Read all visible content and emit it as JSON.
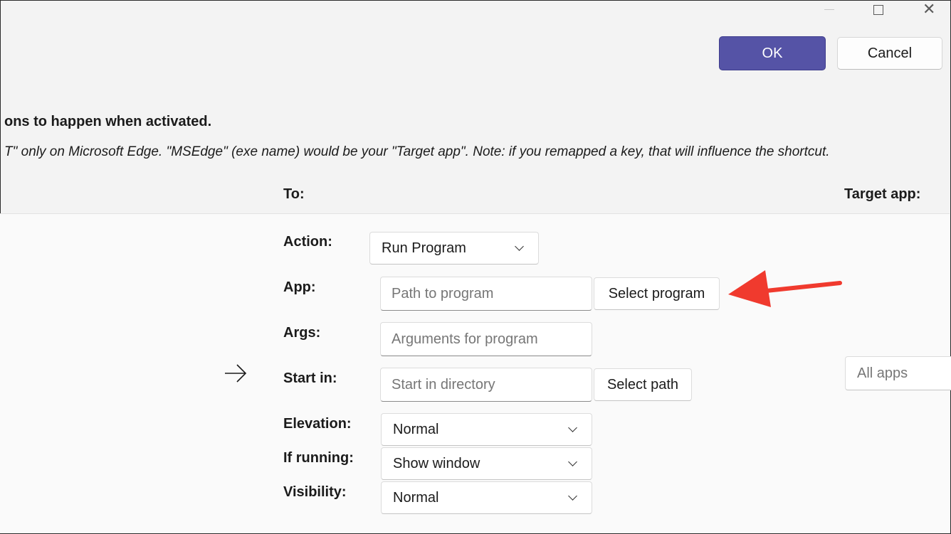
{
  "dialog": {
    "ok_label": "OK",
    "cancel_label": "Cancel",
    "info_line1": "ons to happen when activated.",
    "info_line2": "T\" only on Microsoft Edge. \"MSEdge\" (exe name) would be your \"Target app\". Note: if you remapped a key, that will influence the shortcut.",
    "header_to": "To:",
    "header_target": "Target app:"
  },
  "form": {
    "action_label": "Action:",
    "action_value": "Run Program",
    "app_label": "App:",
    "app_placeholder": "Path to program",
    "select_program_label": "Select program",
    "args_label": "Args:",
    "args_placeholder": "Arguments for program",
    "startin_label": "Start in:",
    "startin_placeholder": "Start in directory",
    "select_path_label": "Select path",
    "elevation_label": "Elevation:",
    "elevation_value": "Normal",
    "ifrunning_label": "If running:",
    "ifrunning_value": "Show window",
    "visibility_label": "Visibility:",
    "visibility_value": "Normal"
  },
  "target": {
    "placeholder": "All apps"
  },
  "colors": {
    "accent": "#5553a6",
    "annotation_arrow": "#f03a2e"
  },
  "icons": [
    "minimize-icon",
    "maximize-icon",
    "close-icon",
    "right-arrow-icon",
    "chevron-down-icon"
  ]
}
